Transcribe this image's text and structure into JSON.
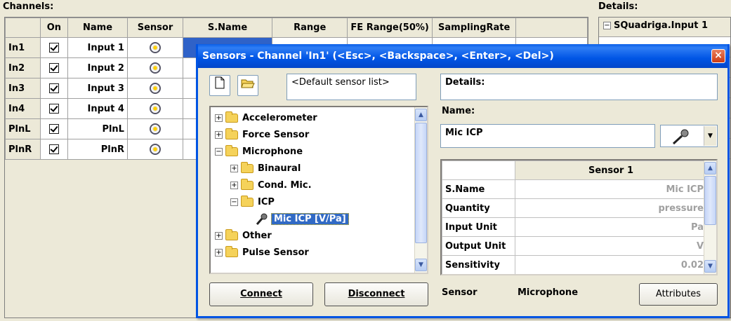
{
  "channels": {
    "label": "Channels:",
    "columns": [
      "On",
      "Name",
      "Sensor",
      "S.Name",
      "Range",
      "FE Range(50%)",
      "SamplingRate"
    ],
    "rows": [
      {
        "id": "In1",
        "on": true,
        "name": "Input 1"
      },
      {
        "id": "In2",
        "on": true,
        "name": "Input 2"
      },
      {
        "id": "In3",
        "on": true,
        "name": "Input 3"
      },
      {
        "id": "In4",
        "on": true,
        "name": "Input 4"
      },
      {
        "id": "PlnL",
        "on": true,
        "name": "PlnL"
      },
      {
        "id": "PlnR",
        "on": true,
        "name": "PlnR"
      }
    ]
  },
  "details_panel": {
    "label": "Details:",
    "root_item": "SQuadriga.Input 1"
  },
  "dialog": {
    "title": "Sensors - Channel 'In1' (<Esc>, <Backspace>, <Enter>, <Del>)",
    "close_label": "×",
    "sensor_list": "<Default sensor list>",
    "details_label": "Details:",
    "name_label": "Name:",
    "name_value": "Mic ICP",
    "tree": [
      {
        "label": "Accelerometer",
        "expander": "+",
        "level": 0
      },
      {
        "label": "Force Sensor",
        "expander": "+",
        "level": 0
      },
      {
        "label": "Microphone",
        "expander": "−",
        "level": 0
      },
      {
        "label": "Binaural",
        "expander": "+",
        "level": 1
      },
      {
        "label": "Cond. Mic.",
        "expander": "+",
        "level": 1
      },
      {
        "label": "ICP",
        "expander": "−",
        "level": 1
      },
      {
        "label": "Mic ICP [V/Pa]",
        "expander": "",
        "level": 2,
        "selected": true
      },
      {
        "label": "Other",
        "expander": "+",
        "level": 0
      },
      {
        "label": "Pulse Sensor",
        "expander": "+",
        "level": 0
      }
    ],
    "sensor_table": {
      "header": "Sensor 1",
      "rows": [
        {
          "key": "S.Name",
          "value": "Mic ICP"
        },
        {
          "key": "Quantity",
          "value": "pressure"
        },
        {
          "key": "Input Unit",
          "value": "Pa"
        },
        {
          "key": "Output Unit",
          "value": "V"
        },
        {
          "key": "Sensitivity",
          "value": "0.02"
        }
      ]
    },
    "connect_label": "Connect",
    "disconnect_label": "Disconnect",
    "sensor_label": "Sensor",
    "sensor_type": "Microphone",
    "attributes_label": "Attributes"
  }
}
